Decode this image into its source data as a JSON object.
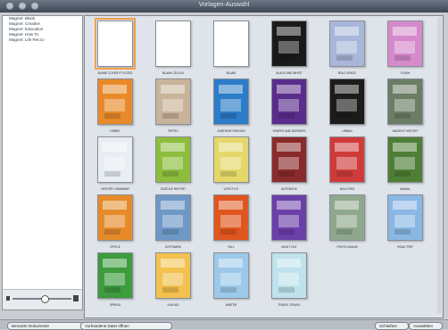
{
  "window": {
    "title": "Vorlagen-Auswahl"
  },
  "sidebar": {
    "items": [
      {
        "label": "Magnet: Blank"
      },
      {
        "label": "Magnet: Creative"
      },
      {
        "label": "Magnet: Education"
      },
      {
        "label": "Magnet: How To"
      },
      {
        "label": "Magnet: Life Recco"
      }
    ],
    "zoom": 0.55
  },
  "colors": {
    "orange": "#e88a2a",
    "teal": "#3f8f9a",
    "blue": "#2c7cc8",
    "purple": "#5a2d8d",
    "black": "#1a1a1a",
    "green": "#3e9b3e",
    "maroon": "#8a2b2b",
    "lightblue": "#8ab7e3",
    "pink": "#d86ab7",
    "gray": "#6f7376"
  },
  "templates": [
    {
      "label": "Blank Cover Stylized",
      "bg": "#ffffff",
      "selected": true
    },
    {
      "label": "Blank Cellus",
      "bg": "#ffffff"
    },
    {
      "label": "Blank",
      "bg": "#ffffff"
    },
    {
      "label": "Black and White",
      "bg": "#1a1a1a"
    },
    {
      "label": "Bold Space",
      "bg": "#a8b7d9"
    },
    {
      "label": "Flash",
      "bg": "#d48acb"
    },
    {
      "label": "Hobby",
      "bg": "#e88a2a"
    },
    {
      "label": "Retro",
      "bg": "#c9b39a"
    },
    {
      "label": "Surfside Fashion",
      "bg": "#2c7cc8"
    },
    {
      "label": "Shapes and Borders",
      "bg": "#5a2d8d"
    },
    {
      "label": "Urban",
      "bg": "#1c1c1c"
    },
    {
      "label": "Ancient History",
      "bg": "#6b7d65"
    },
    {
      "label": "History Grammar",
      "bg": "#e8eef3"
    },
    {
      "label": "Science Report",
      "bg": "#8dbd3d"
    },
    {
      "label": "Lifestyle",
      "bg": "#e4d86a"
    },
    {
      "label": "Notebook",
      "bg": "#8a2b2b"
    },
    {
      "label": "Bold Red",
      "bg": "#cf3b3b"
    },
    {
      "label": "Animal",
      "bg": "#4f7f36"
    },
    {
      "label": "Office",
      "bg": "#e58b2a"
    },
    {
      "label": "Software",
      "bg": "#6f98c7"
    },
    {
      "label": "Fall",
      "bg": "#e0561f"
    },
    {
      "label": "Night Out",
      "bg": "#6b3fa8"
    },
    {
      "label": "Photo Album",
      "bg": "#8fa88d"
    },
    {
      "label": "Road Trip",
      "bg": "#8ab7e3"
    },
    {
      "label": "Spring",
      "bg": "#3e9b3e"
    },
    {
      "label": "Sun Kid",
      "bg": "#f2c14e"
    },
    {
      "label": "Winter",
      "bg": "#9cc9ea"
    },
    {
      "label": "Travel Travel",
      "bg": "#bfe2ec"
    }
  ],
  "buttons": {
    "recent_documents": "Benutzte Dokumente",
    "open_existing": "Vorhandene Datei öffnen",
    "close": "Schließen",
    "choose": "Auswählen"
  }
}
